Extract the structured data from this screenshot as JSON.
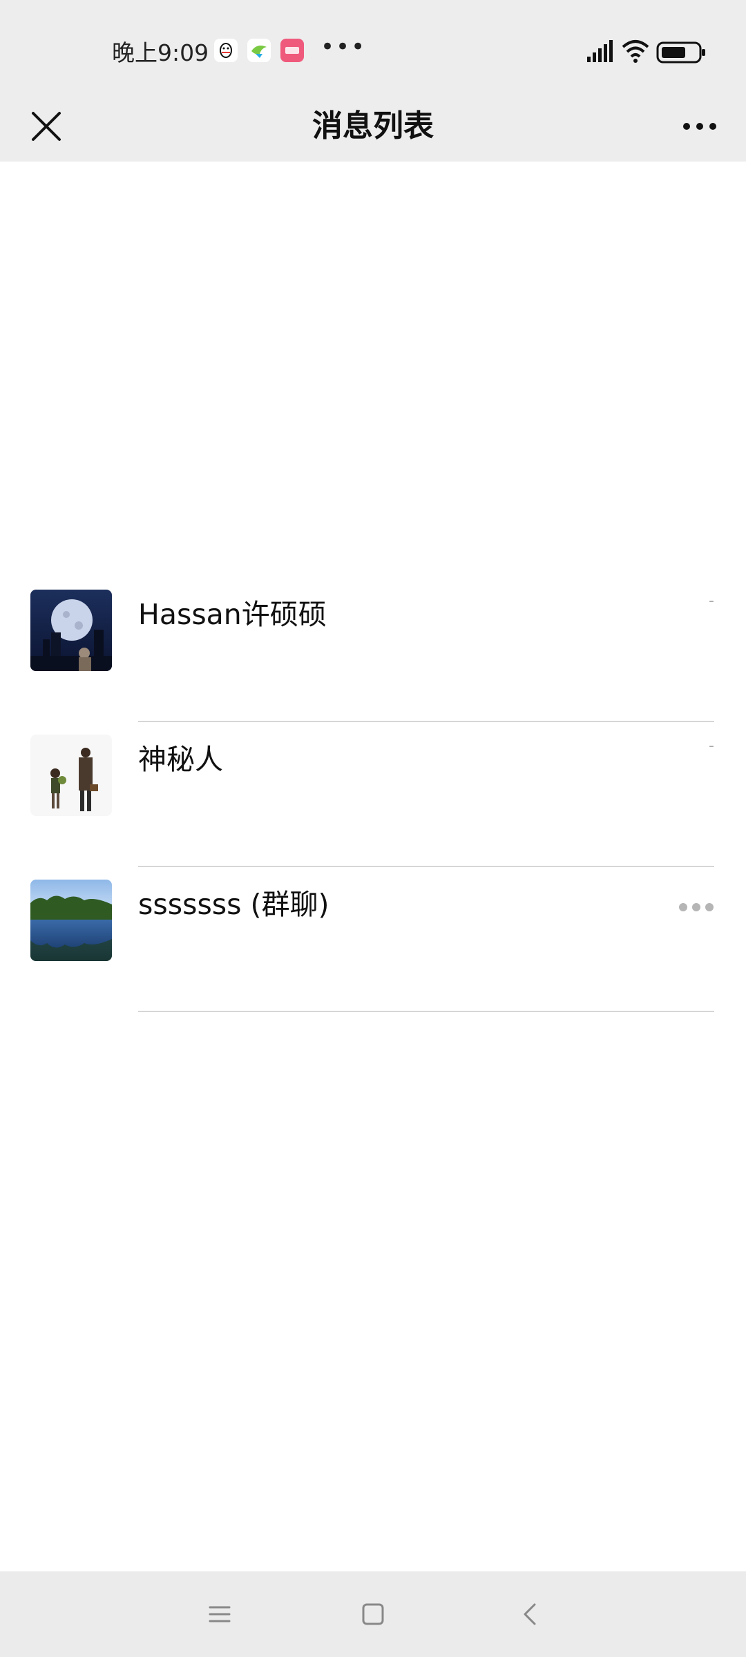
{
  "status_bar": {
    "time": "晚上9:09",
    "more": "•••",
    "apps": [
      "qq-icon",
      "bird-icon",
      "red-app-icon"
    ],
    "right_icons": [
      "signal-icon",
      "wifi-icon",
      "battery-icon"
    ]
  },
  "nav": {
    "title": "消息列表",
    "close_icon": "close-icon",
    "more_icon": "more-horizontal-icon"
  },
  "chats": [
    {
      "name": "Hassan许硕硕",
      "time": "-",
      "avatar_icon": "moon-city-avatar",
      "typing": false
    },
    {
      "name": "神秘人",
      "time": "-",
      "avatar_icon": "leon-avatar",
      "typing": false
    },
    {
      "name": "sssssss (群聊)",
      "time": "",
      "avatar_icon": "lake-forest-avatar",
      "typing": true
    }
  ],
  "system_nav": {
    "icons": [
      "menu-icon",
      "home-icon",
      "back-icon"
    ]
  },
  "colors": {
    "header_bg": "#ededed",
    "text_primary": "#111111",
    "divider": "#d6d6d6",
    "accent_red_app": "#ef5a7c"
  }
}
